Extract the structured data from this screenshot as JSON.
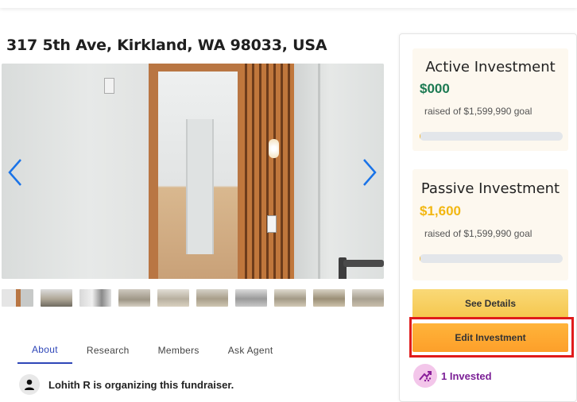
{
  "property": {
    "address": "317 5th Ave, Kirkland, WA 98033, USA"
  },
  "gallery": {
    "prev_icon": "chevron-left-icon",
    "next_icon": "chevron-right-icon",
    "thumbnail_count": 10,
    "arrow_color": "#1a73e8"
  },
  "tabs": [
    {
      "label": "About",
      "active": true
    },
    {
      "label": "Research",
      "active": false
    },
    {
      "label": "Members",
      "active": false
    },
    {
      "label": "Ask Agent",
      "active": false
    }
  ],
  "organizer": {
    "text": "Lohith R is organizing this fundraiser.",
    "icon": "user-icon"
  },
  "investments": {
    "active": {
      "title": "Active Investment",
      "amount": "$000",
      "goal_text": "raised of $1,599,990 goal",
      "progress_fraction": 0.0
    },
    "passive": {
      "title": "Passive Investment",
      "amount": "$1,600",
      "goal_text": "raised of $1,599,990 goal",
      "progress_fraction": 0.001
    }
  },
  "actions": {
    "see_details_label": "See Details",
    "edit_investment_label": "Edit Investment"
  },
  "invested": {
    "text": "1 Invested",
    "icon": "investors-icon"
  },
  "colors": {
    "tab_active": "#2e46b8",
    "active_amount": "#1c7a52",
    "passive_amount": "#f2b712",
    "highlight": "#e01b1b",
    "invested_text": "#7b1f96"
  }
}
